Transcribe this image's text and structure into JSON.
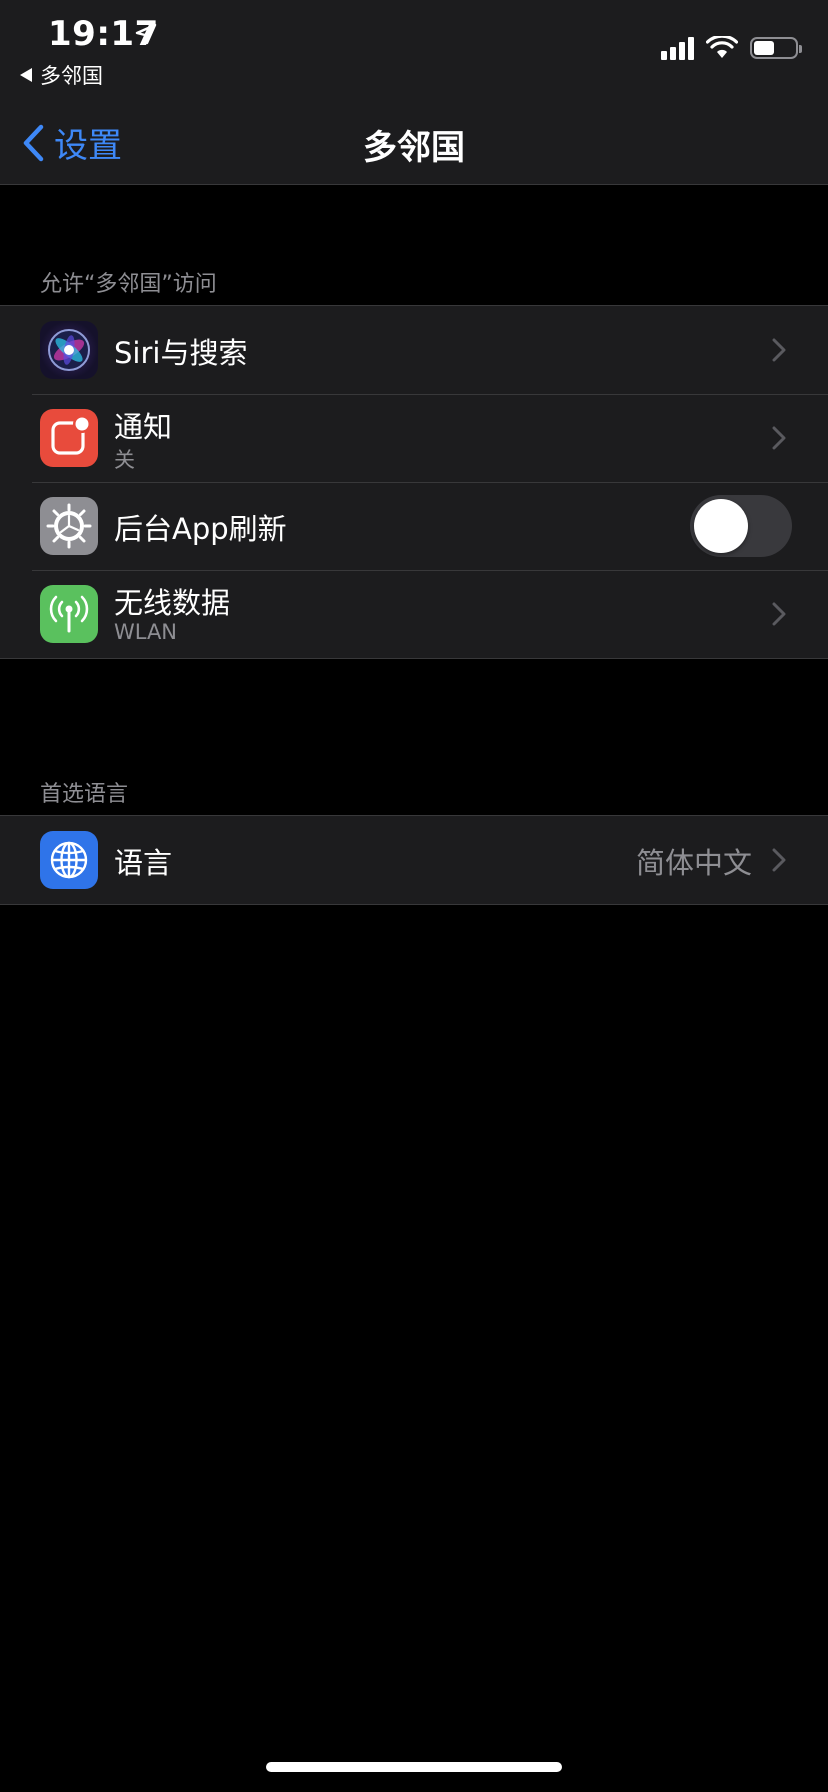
{
  "status_bar": {
    "time": "19:17",
    "back_app": "多邻国",
    "icons": [
      "location-arrow-icon",
      "cellular-signal-icon",
      "wifi-icon",
      "battery-icon"
    ],
    "battery_level": 0.5
  },
  "nav": {
    "back_label": "设置",
    "title": "多邻国"
  },
  "sections": {
    "access_header": "允许“多邻国”访问",
    "language_header": "首选语言"
  },
  "rows": {
    "siri": {
      "title": "Siri与搜索",
      "icon": "siri-icon"
    },
    "notifications": {
      "title": "通知",
      "subtitle": "关",
      "icon": "notification-icon"
    },
    "background_refresh": {
      "title": "后台App刷新",
      "icon": "gear-icon",
      "toggle_on": false
    },
    "wireless_data": {
      "title": "无线数据",
      "subtitle": "WLAN",
      "icon": "antenna-icon"
    },
    "language": {
      "title": "语言",
      "value": "简体中文",
      "icon": "globe-icon"
    }
  },
  "colors": {
    "accent": "#3e88f7",
    "notification_icon_bg": "#e84b3c",
    "wireless_icon_bg": "#5ac15e",
    "language_icon_bg": "#2f74e9",
    "gear_icon_bg": "#8e8e93"
  }
}
